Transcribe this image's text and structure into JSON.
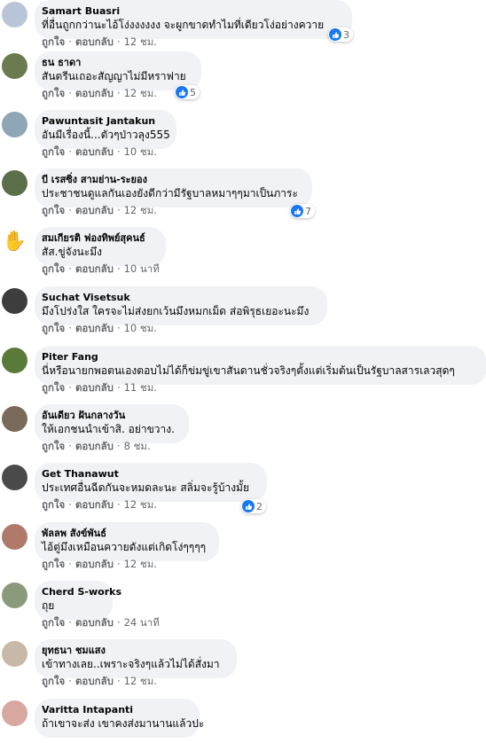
{
  "actions": {
    "like_label": "ถูกใจ",
    "reply_label": "ตอบกลับ",
    "separator": "·"
  },
  "comments": [
    {
      "author": "Samart Buasri",
      "text": "ที่อื่นถูกกว่านะไอ้โง่งงงงงง จะผูกขาดทำไมที่เดียวโง่อย่างควาย",
      "time": "12 ชม.",
      "reactions": "3",
      "avatar_color": "#b8c6d8",
      "avatar_icon": "profile-photo"
    },
    {
      "author": "ธน ธาดา",
      "text": "สันตรีนเถอะสัญญาไม่มีหราฟาย",
      "time": "12 ชม.",
      "reactions": "5",
      "avatar_color": "#6b7a4f",
      "avatar_icon": "profile-photo"
    },
    {
      "author": "Pawuntasit Jantakun",
      "text": "อันมีเรื่องนี้...ตัวๆป่าวลุง555",
      "time": "10 ชม.",
      "reactions": "",
      "avatar_color": "#8fa6b6",
      "avatar_icon": "profile-photo"
    },
    {
      "author": "บี เรสซิ่ง สามย่าน-ระยอง",
      "text": "ประชาชนดูแลกันเองยังดีกว่ามีรัฐบาลหมาๆๆมาเป็นภาระ",
      "time": "12 ชม.",
      "reactions": "7",
      "avatar_color": "#5b6e4a",
      "avatar_icon": "profile-photo"
    },
    {
      "author": "สมเกียรติ ฟองทิพย์สุคนธ์",
      "text": "สัส.ขู่จังนะมึง",
      "time": "10 นาที",
      "reactions": "",
      "avatar_color": "#ffffff",
      "avatar_icon": "hand-icon"
    },
    {
      "author": "Suchat Visetsuk",
      "text": "มึงโปร่งใส ใครจะไม่ส่งยกเว้นมึงหมกเม็ด ส่อพิรุธเยอะนะมึง",
      "time": "10 ชม.",
      "reactions": "",
      "avatar_color": "#3d3d3d",
      "avatar_icon": "profile-photo"
    },
    {
      "author": "Piter Fang",
      "text": "นี่หรือนายกพอตนเองตอบไม่ได้ก็ข่มขู่เขาสันดานชั่วจริงๆตั้งแต่เริ่มต้นเป็นรัฐบาลสารเลวสุดๆ",
      "time": "11 ชม.",
      "reactions": "",
      "avatar_color": "#5a7a3a",
      "avatar_icon": "profile-photo"
    },
    {
      "author": "อันเดียว ฝันกลางวัน",
      "text": "ให้เอกชนนำเข้าสิ. อย่าขวาง.",
      "time": "8 ชม.",
      "reactions": "",
      "avatar_color": "#7a6a5a",
      "avatar_icon": "profile-photo"
    },
    {
      "author": "Get Thanawut",
      "text": "ประเทศอื่นฉีดกันจะหมดละนะ สลิ่มจะรู้บ้างมั้ย",
      "time": "12 ชม.",
      "reactions": "2",
      "avatar_color": "#4a4a4a",
      "avatar_icon": "profile-photo"
    },
    {
      "author": "พัลลพ สังข์พันธ์",
      "text": "ไอ้ตู่มึงเหมือนควายดังแต่เกิดโง่ๆๆๆๆ",
      "time": "12 ชม.",
      "reactions": "",
      "avatar_color": "#b07a6a",
      "avatar_icon": "profile-photo"
    },
    {
      "author": "Cherd S-works",
      "text": "ถุย",
      "time": "24 นาที",
      "reactions": "",
      "avatar_color": "#8a9a7a",
      "avatar_icon": "profile-photo"
    },
    {
      "author": "ยุทธนา ชมแสง",
      "text": "เข้าทางเลย..เพราะจริงๆแล้วไม่ได้สั่งมา",
      "time": "12 ชม.",
      "reactions": "",
      "avatar_color": "#c8b8a8",
      "avatar_icon": "profile-photo"
    },
    {
      "author": "Varitta Intapanti",
      "text": "ถ้าเขาจะส่ง เขาคงส่งมานานแล้วปะ",
      "time": "",
      "reactions": "",
      "avatar_color": "#d8a8a0",
      "avatar_icon": "profile-photo"
    }
  ]
}
